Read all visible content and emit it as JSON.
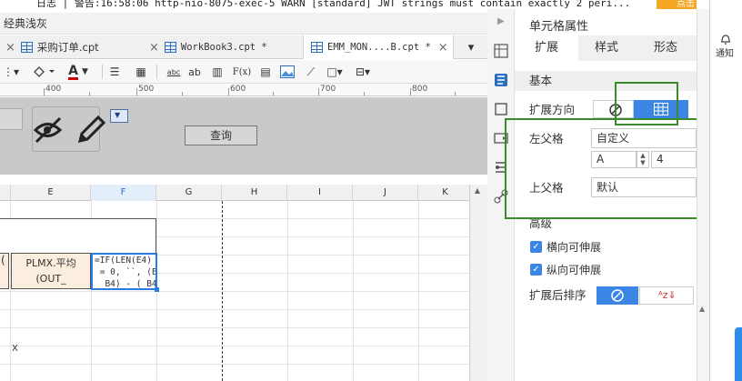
{
  "log": {
    "text": "日志 | 警告:16:58:06 http-nio-8075-exec-5 WARN [standard] JWT strings must contain exactly 2 peri..."
  },
  "top_right": {
    "button_label": "点击"
  },
  "theme": {
    "label": "经典浅灰"
  },
  "tabs": [
    {
      "label": "采购订单.cpt"
    },
    {
      "label": "WorkBook3.cpt *"
    },
    {
      "label": "EMM_MON....B.cpt *"
    }
  ],
  "toolbar": {
    "abc_label": "abc",
    "ab_label": "ab",
    "fx_label": "F(x)"
  },
  "ruler": {
    "marks": [
      "400",
      "500",
      "600",
      "700",
      "800"
    ]
  },
  "param": {
    "query_button": "查询"
  },
  "grid": {
    "columns": [
      "E",
      "F",
      "G",
      "H",
      "I",
      "J",
      "K"
    ],
    "selected_column": "F",
    "cellD": "(",
    "cellE": "PLMX.平均(OUT_",
    "cellF_lines": [
      "=IF(LEN(E4)",
      " = 0, ``, (E4",
      "  B4) - ( B4"
    ],
    "x_mark": "X"
  },
  "panel": {
    "title": "单元格属性",
    "tabs": [
      "扩展",
      "样式",
      "形态"
    ],
    "section_basic": "基本",
    "expand_direction_label": "扩展方向",
    "left_parent_label": "左父格",
    "left_parent_value": "自定义",
    "left_parent_col": "A",
    "left_parent_row": "4",
    "top_parent_label": "上父格",
    "top_parent_value": "默认",
    "section_advanced": "高级",
    "h_stretch_label": "横向可伸展",
    "v_stretch_label": "纵向可伸展",
    "sort_label": "扩展后排序"
  },
  "far_right": {
    "notification_label": "通知"
  },
  "colors": {
    "accent": "#3b86e5",
    "highlight_box": "#3c8a2e",
    "selected_cell": "#2b7ce0"
  }
}
